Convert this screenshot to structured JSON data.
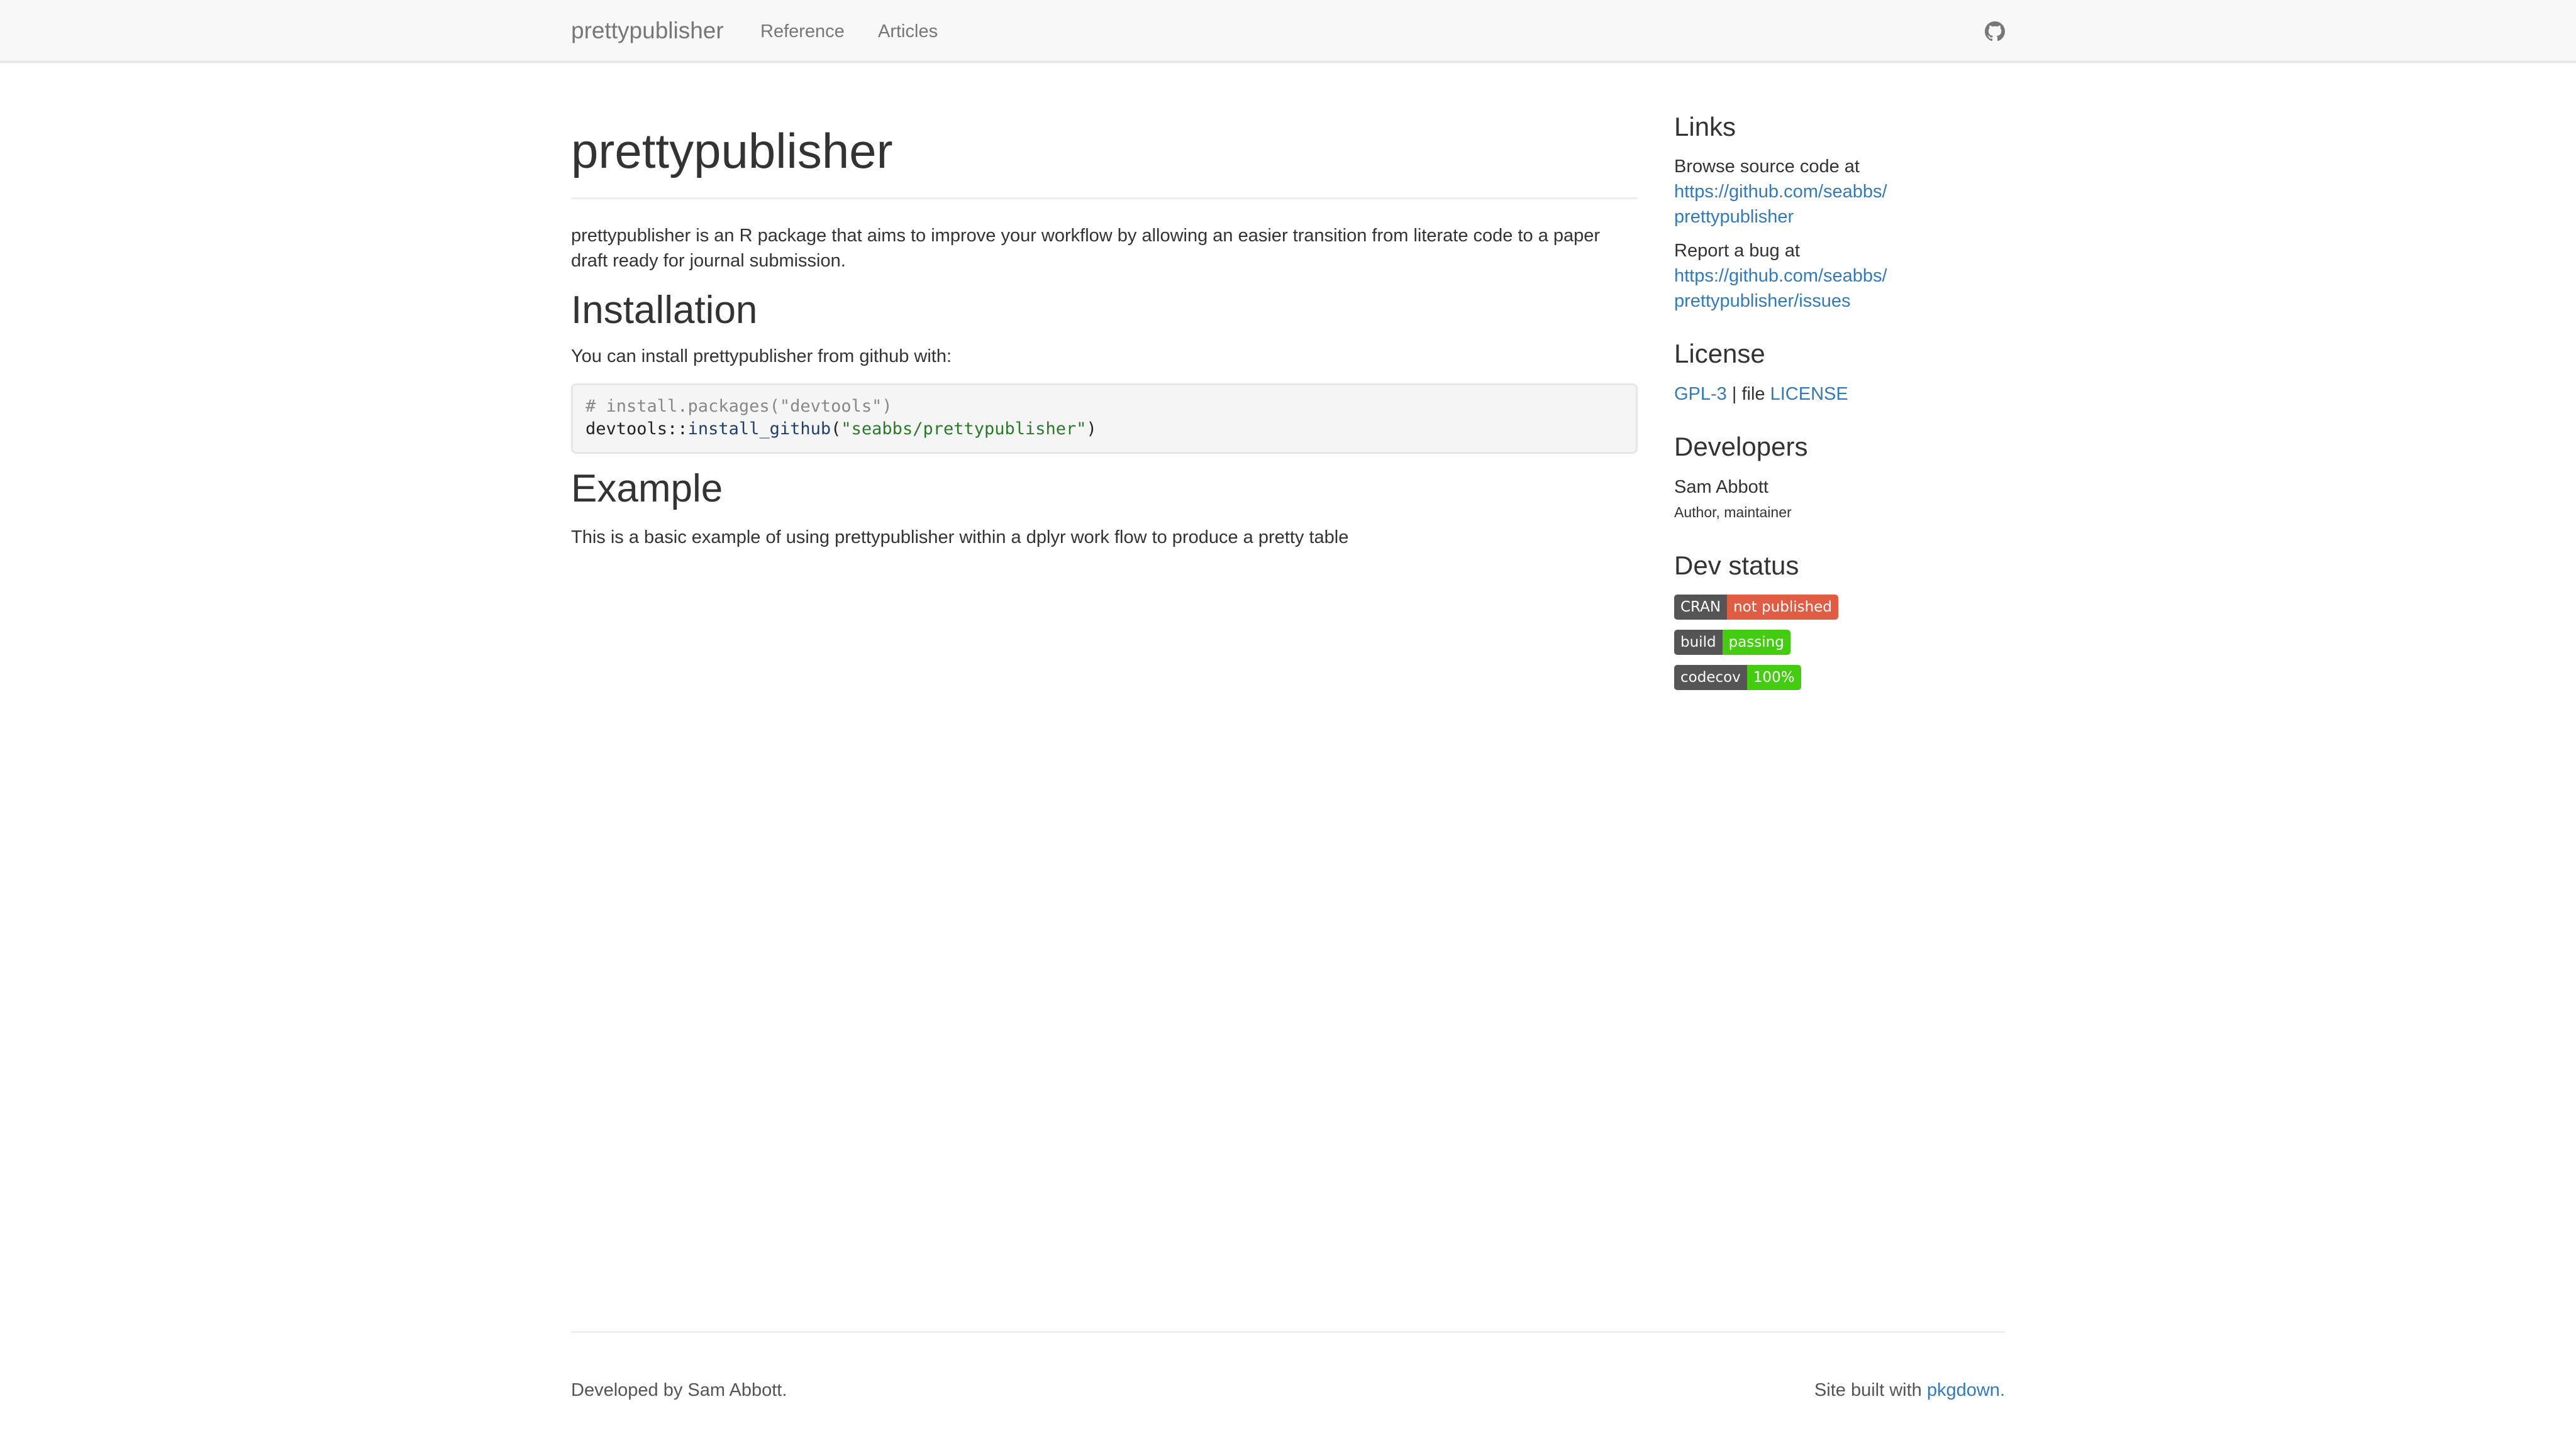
{
  "navbar": {
    "brand": "prettypublisher",
    "items": [
      {
        "label": "Reference"
      },
      {
        "label": "Articles"
      }
    ],
    "github_icon": "github-icon"
  },
  "main": {
    "title": "prettypublisher",
    "intro": "prettypublisher is an R package that aims to improve your workflow by allowing an easier transition from literate code to a paper draft ready for journal submission.",
    "installation": {
      "heading": "Installation",
      "text": "You can install prettypublisher from github with:",
      "code": {
        "comment": "# install.packages(\"devtools\")",
        "line2_prefix": "devtools::",
        "line2_fn": "install_github",
        "line2_open": "(",
        "line2_str": "\"seabbs/prettypublisher\"",
        "line2_close": ")"
      }
    },
    "example": {
      "heading": "Example",
      "text": "This is a basic example of using prettypublisher within a dplyr work flow to produce a pretty table"
    }
  },
  "sidebar": {
    "links": {
      "heading": "Links",
      "browse_label": "Browse source code at",
      "browse_url_line1": "https://github.com/seabbs/",
      "browse_url_line2": "prettypublisher",
      "bug_label": "Report a bug at",
      "bug_url_line1": "https://github.com/seabbs/",
      "bug_url_line2": "prettypublisher/issues"
    },
    "license": {
      "heading": "License",
      "gpl": "GPL-3",
      "separator": " | file ",
      "file": "LICENSE"
    },
    "developers": {
      "heading": "Developers",
      "name": "Sam Abbott",
      "role": "Author, maintainer"
    },
    "dev_status": {
      "heading": "Dev status",
      "badges": [
        {
          "left": "CRAN",
          "right": "not published",
          "color": "#e05d44"
        },
        {
          "left": "build",
          "right": "passing",
          "color": "#4c1"
        },
        {
          "left": "codecov",
          "right": "100%",
          "color": "#4c1"
        }
      ]
    }
  },
  "footer": {
    "left": "Developed by Sam Abbott.",
    "right_prefix": "Site built with ",
    "right_link": "pkgdown",
    "right_suffix": "."
  },
  "colors": {
    "link": "#337ab7",
    "navbar_bg": "#f8f8f8"
  }
}
